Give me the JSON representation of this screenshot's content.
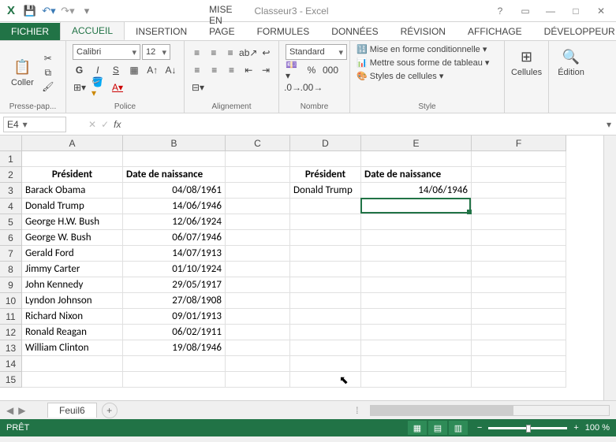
{
  "window": {
    "title": "Classeur3 - Excel"
  },
  "qat": {
    "save": "save",
    "undo": "undo",
    "redo": "redo"
  },
  "tabs": {
    "file": "FICHIER",
    "items": [
      "ACCUEIL",
      "INSERTION",
      "MISE EN PAGE",
      "FORMULES",
      "DONNÉES",
      "RÉVISION",
      "AFFICHAGE",
      "DÉVELOPPEUR"
    ],
    "active": 0
  },
  "ribbon": {
    "clipboard": {
      "paste": "Coller",
      "title": "Presse-pap..."
    },
    "font": {
      "name": "Calibri",
      "size": "12",
      "bold": "G",
      "italic": "I",
      "underline": "S",
      "title": "Police"
    },
    "alignment": {
      "title": "Alignement"
    },
    "number": {
      "format": "Standard",
      "title": "Nombre"
    },
    "styles": {
      "cond": "Mise en forme conditionnelle",
      "table": "Mettre sous forme de tableau",
      "cell": "Styles de cellules",
      "title": "Style"
    },
    "cells": {
      "label": "Cellules"
    },
    "editing": {
      "label": "Édition"
    }
  },
  "namebox": "E4",
  "fx": "",
  "columns": [
    {
      "l": "A",
      "w": 128
    },
    {
      "l": "B",
      "w": 130
    },
    {
      "l": "C",
      "w": 82
    },
    {
      "l": "D",
      "w": 90
    },
    {
      "l": "E",
      "w": 140
    },
    {
      "l": "F",
      "w": 120
    }
  ],
  "rows": 15,
  "cells": [
    {
      "r": 2,
      "c": "A",
      "v": "Président",
      "bold": true,
      "align": "center"
    },
    {
      "r": 2,
      "c": "B",
      "v": "Date de naissance",
      "bold": true
    },
    {
      "r": 3,
      "c": "A",
      "v": "Barack Obama"
    },
    {
      "r": 3,
      "c": "B",
      "v": "04/08/1961",
      "align": "right"
    },
    {
      "r": 4,
      "c": "A",
      "v": "Donald Trump"
    },
    {
      "r": 4,
      "c": "B",
      "v": "14/06/1946",
      "align": "right"
    },
    {
      "r": 5,
      "c": "A",
      "v": "George H.W. Bush"
    },
    {
      "r": 5,
      "c": "B",
      "v": "12/06/1924",
      "align": "right"
    },
    {
      "r": 6,
      "c": "A",
      "v": "George W. Bush"
    },
    {
      "r": 6,
      "c": "B",
      "v": "06/07/1946",
      "align": "right"
    },
    {
      "r": 7,
      "c": "A",
      "v": "Gerald Ford"
    },
    {
      "r": 7,
      "c": "B",
      "v": "14/07/1913",
      "align": "right"
    },
    {
      "r": 8,
      "c": "A",
      "v": "Jimmy Carter"
    },
    {
      "r": 8,
      "c": "B",
      "v": "01/10/1924",
      "align": "right"
    },
    {
      "r": 9,
      "c": "A",
      "v": "John Kennedy"
    },
    {
      "r": 9,
      "c": "B",
      "v": "29/05/1917",
      "align": "right"
    },
    {
      "r": 10,
      "c": "A",
      "v": "Lyndon Johnson"
    },
    {
      "r": 10,
      "c": "B",
      "v": "27/08/1908",
      "align": "right"
    },
    {
      "r": 11,
      "c": "A",
      "v": "Richard Nixon"
    },
    {
      "r": 11,
      "c": "B",
      "v": "09/01/1913",
      "align": "right"
    },
    {
      "r": 12,
      "c": "A",
      "v": "Ronald Reagan"
    },
    {
      "r": 12,
      "c": "B",
      "v": "06/02/1911",
      "align": "right"
    },
    {
      "r": 13,
      "c": "A",
      "v": "William Clinton"
    },
    {
      "r": 13,
      "c": "B",
      "v": "19/08/1946",
      "align": "right"
    },
    {
      "r": 2,
      "c": "D",
      "v": "Président",
      "bold": true,
      "align": "center"
    },
    {
      "r": 2,
      "c": "E",
      "v": "Date de naissance",
      "bold": true
    },
    {
      "r": 3,
      "c": "D",
      "v": "Donald Trump"
    },
    {
      "r": 3,
      "c": "E",
      "v": "14/06/1946",
      "align": "right"
    }
  ],
  "active_cell": {
    "r": 4,
    "c": "E"
  },
  "sheet": {
    "tab": "Feuil6"
  },
  "status": {
    "ready": "PRÊT",
    "zoom": "100 %"
  }
}
